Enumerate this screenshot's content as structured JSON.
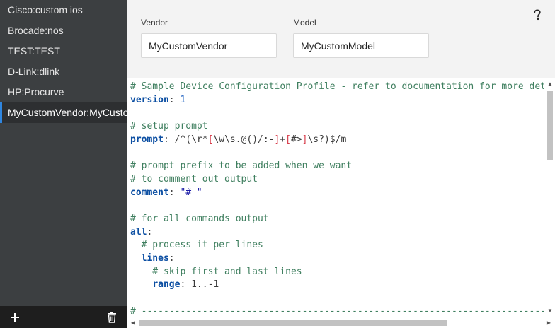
{
  "sidebar": {
    "items": [
      {
        "label": "Cisco:custom ios"
      },
      {
        "label": "Brocade:nos"
      },
      {
        "label": "TEST:TEST"
      },
      {
        "label": "D-Link:dlink"
      },
      {
        "label": "HP:Procurve"
      },
      {
        "label": "MyCustomVendor:MyCustomModel"
      }
    ],
    "active_index": 5,
    "add_icon": "plus-icon",
    "delete_icon": "trash-icon"
  },
  "form": {
    "vendor_label": "Vendor",
    "vendor_value": "MyCustomVendor",
    "model_label": "Model",
    "model_value": "MyCustomModel",
    "help_icon": "help-icon"
  },
  "editor": {
    "line1": "# Sample Device Configuration Profile - refer to documentation for more details",
    "line2_key": "version",
    "line2_val": "1",
    "line4": "# setup prompt",
    "line5_key": "prompt",
    "line5_r1": "/^(\\r*",
    "line5_r2": "[",
    "line5_r3": "\\w\\s.@()/:-",
    "line5_r4": "]",
    "line5_r5": "+",
    "line5_r6": "[",
    "line5_r7": "#>",
    "line5_r8": "]",
    "line5_r9": "\\s?)$/m",
    "line7": "# prompt prefix to be added when we want",
    "line8": "# to comment out output",
    "line9_key": "comment",
    "line9_val": "\"# \"",
    "line11": "# for all commands output",
    "line12_key": "all",
    "line13": "  # process it per lines",
    "line14_key": "lines",
    "line15": "    # skip first and last lines",
    "line16_key": "range",
    "line16_val": "1..-1",
    "line18": "# -------------------------------------------------------------------------------------"
  },
  "colors": {
    "sidebar_bg": "#3c3f41",
    "active_accent": "#2f86e0",
    "comment": "#3f7f5f",
    "key": "#0b4ea2",
    "regex_bracket": "#d73a49"
  }
}
